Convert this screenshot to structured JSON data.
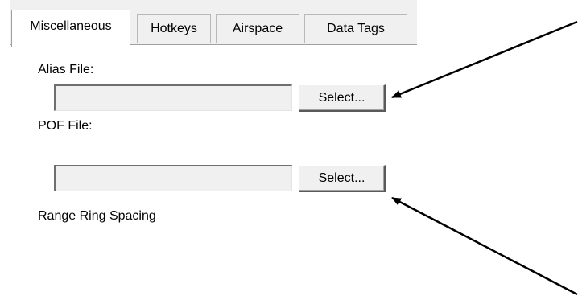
{
  "tabs": [
    {
      "label": "Miscellaneous",
      "active": true
    },
    {
      "label": "Hotkeys",
      "active": false
    },
    {
      "label": "Airspace",
      "active": false
    },
    {
      "label": "Data Tags",
      "active": false
    }
  ],
  "alias_file": {
    "label": "Alias File:",
    "value": "",
    "button_label": "Select..."
  },
  "pof_file": {
    "label": "POF File:",
    "value": "",
    "button_label": "Select..."
  },
  "range_ring": {
    "label": "Range Ring Spacing"
  },
  "colors": {
    "dialog_background": "#f0f0f0",
    "panel_background": "#ffffff",
    "annotation_arrow": "#000000"
  }
}
